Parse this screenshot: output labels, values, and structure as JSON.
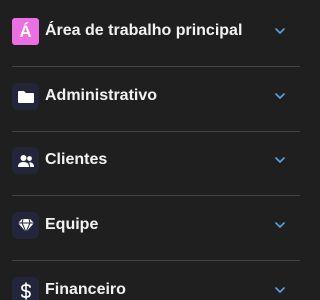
{
  "menu": {
    "items": [
      {
        "label": "Área de trabalho principal",
        "icon": "letter-a-accent-icon",
        "icon_text": "Á"
      },
      {
        "label": "Administrativo",
        "icon": "folder-icon"
      },
      {
        "label": "Clientes",
        "icon": "users-icon"
      },
      {
        "label": "Equipe",
        "icon": "diamond-icon"
      },
      {
        "label": "Financeiro",
        "icon": "dollar-icon"
      }
    ]
  },
  "colors": {
    "background": "#1f1f1f",
    "accent": "#ea6fe2",
    "icon_tile": "#23263a",
    "chevron": "#5aa0e6",
    "divider": "#444444",
    "text": "#f2f2f2"
  }
}
